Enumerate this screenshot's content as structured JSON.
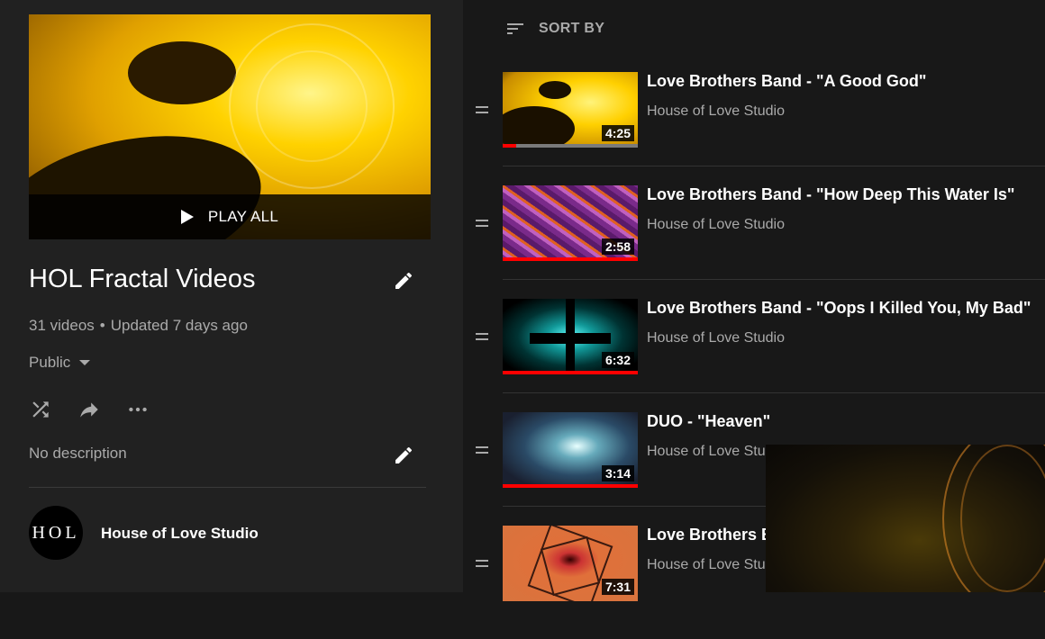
{
  "playlist": {
    "play_all_label": "PLAY ALL",
    "title": "HOL Fractal Videos",
    "video_count": "31 videos",
    "updated": "Updated 7 days ago",
    "privacy": "Public",
    "description": "No description",
    "owner_avatar_text": "HOL",
    "owner_name": "House of Love Studio"
  },
  "sort_label": "SORT BY",
  "videos": [
    {
      "title": "Love Brothers Band - \"A Good God\"",
      "channel": "House of Love Studio",
      "duration": "4:25",
      "watched_fraction": 0.1
    },
    {
      "title": "Love Brothers Band - \"How Deep This Water Is\"",
      "channel": "House of Love Studio",
      "duration": "2:58",
      "watched_fraction": 1.0
    },
    {
      "title": "Love Brothers Band - \"Oops I Killed You, My Bad\"",
      "channel": "House of Love Studio",
      "duration": "6:32",
      "watched_fraction": 1.0
    },
    {
      "title": "DUO - \"Heaven\"",
      "channel": "House of Love Studio",
      "duration": "3:14",
      "watched_fraction": 1.0
    },
    {
      "title": "Love Brothers Band - \"...\"",
      "channel": "House of Love Studio",
      "duration": "7:31",
      "watched_fraction": 0
    }
  ],
  "colors": {
    "accent_red": "#ff0000",
    "panel_bg": "#212121",
    "page_bg": "#181818"
  }
}
